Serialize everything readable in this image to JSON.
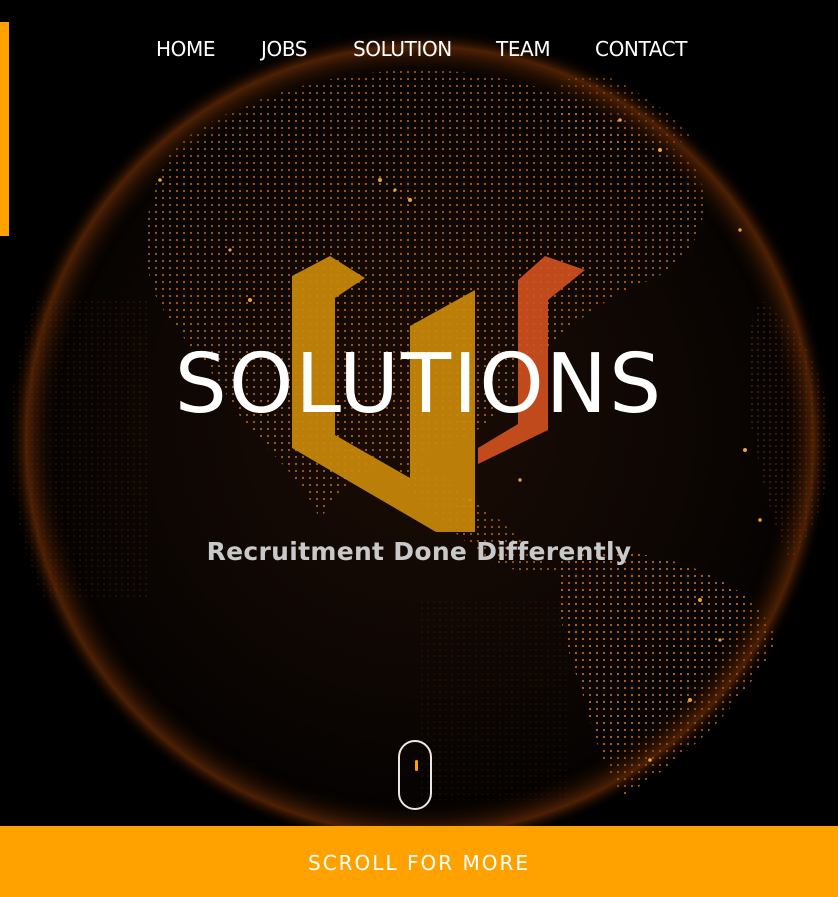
{
  "nav": {
    "items": [
      {
        "label": "HOME"
      },
      {
        "label": "JOBS"
      },
      {
        "label": "SOLUTION"
      },
      {
        "label": "TEAM"
      },
      {
        "label": "CONTACT"
      }
    ]
  },
  "hero": {
    "brand_word": "SOLUTIONS",
    "tagline": "Recruitment Done Differently",
    "background": "glowing-earth-globe-image",
    "logo_mark": "v-shaped-logo-mark"
  },
  "scroll_indicator": {
    "icon": "mouse-scroll-icon"
  },
  "footer": {
    "label": "SCROLL FOR MORE"
  },
  "colors": {
    "accent": "#ffa200",
    "logo_gold": "#c9890a",
    "logo_orange": "#d4521f",
    "globe_glow": "#ff7a1a",
    "background": "#000000"
  }
}
